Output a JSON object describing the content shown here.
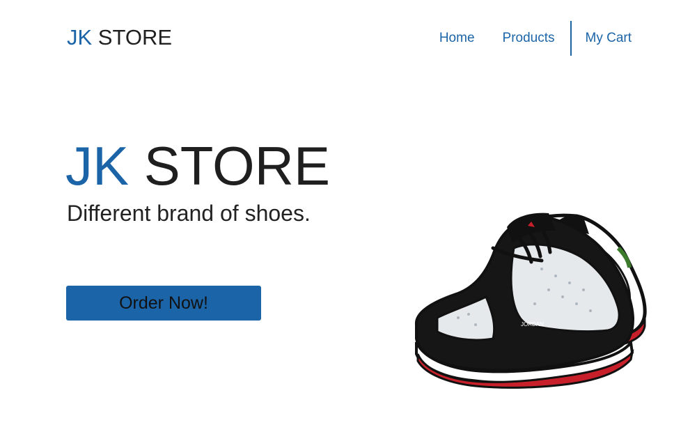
{
  "header": {
    "logo_accent": "JK",
    "logo_rest": " STORE"
  },
  "nav": {
    "items": [
      {
        "label": "Home"
      },
      {
        "label": "Products"
      },
      {
        "label": "My Cart"
      }
    ],
    "color": "#1c64a8"
  },
  "hero": {
    "title_accent": "JK",
    "title_rest": " STORE",
    "subtitle": "Different brand of shoes.",
    "cta_label": "Order Now!",
    "image": "sneakers-illustration",
    "image_brand_text": "JORDAN"
  },
  "colors": {
    "accent": "#1c64a8",
    "text": "#1f1f1f",
    "background": "#ffffff"
  }
}
